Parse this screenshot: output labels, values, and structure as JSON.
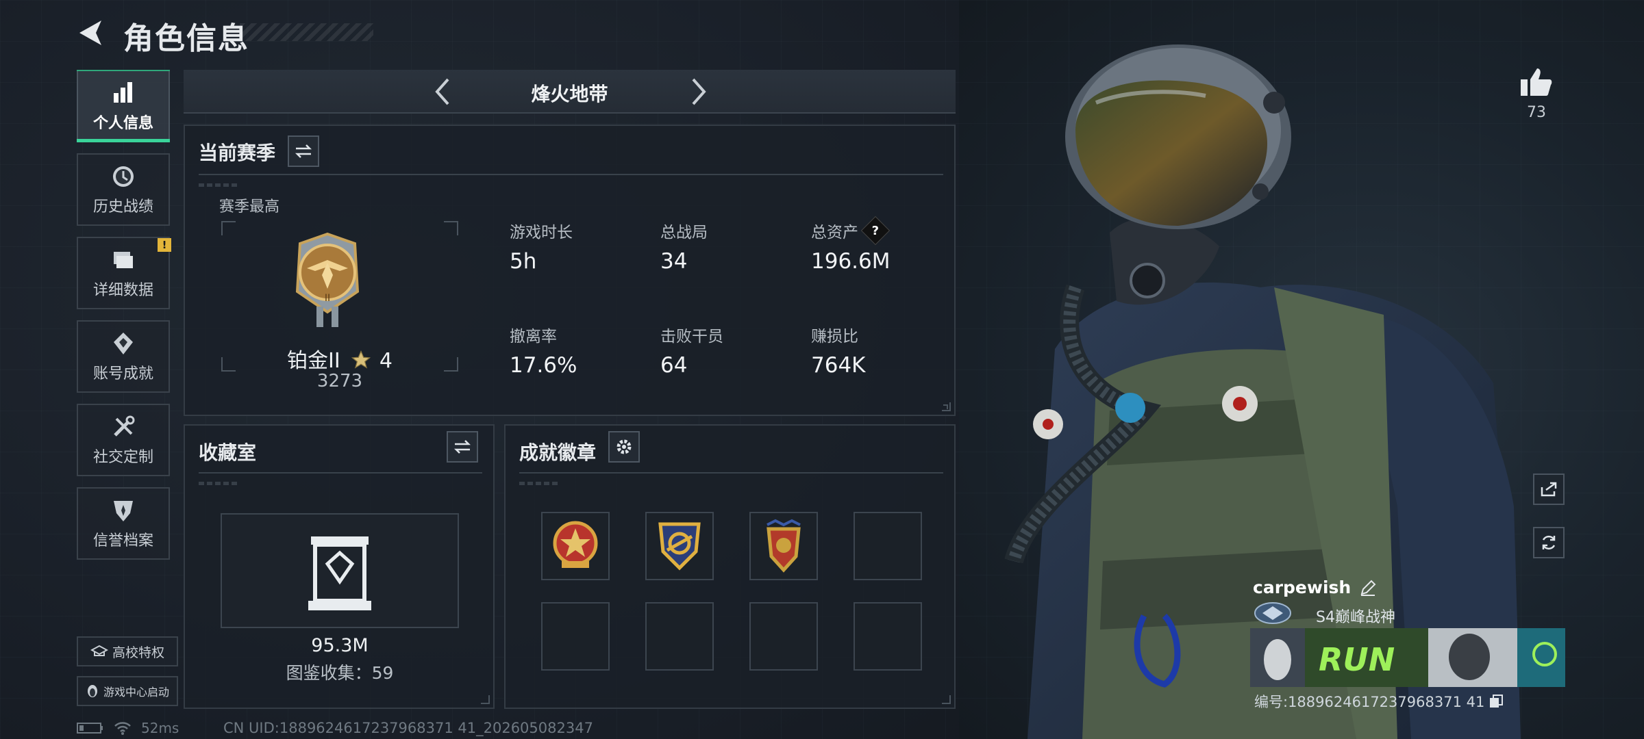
{
  "header": {
    "title": "角色信息"
  },
  "sidebar": {
    "items": [
      {
        "label": "个人信息",
        "icon": "bar-chart-icon",
        "active": true
      },
      {
        "label": "历史战绩",
        "icon": "history-clock-icon"
      },
      {
        "label": "详细数据",
        "icon": "folders-icon",
        "badge": "!"
      },
      {
        "label": "账号成就",
        "icon": "achievement-icon"
      },
      {
        "label": "社交定制",
        "icon": "tools-icon"
      },
      {
        "label": "信誉档案",
        "icon": "shield-star-icon"
      }
    ],
    "campus_label": "高校特权",
    "game_center_label": "游戏中心启动"
  },
  "mode": {
    "title": "烽火地带"
  },
  "season": {
    "header": "当前赛季",
    "best_label": "赛季最高",
    "rank": "铂金II",
    "stars": "4",
    "score": "3273",
    "stats": [
      {
        "label": "游戏时长",
        "value": "5h"
      },
      {
        "label": "总战局",
        "value": "34"
      },
      {
        "label": "总资产",
        "value": "196.6M",
        "help": "?"
      },
      {
        "label": "撤离率",
        "value": "17.6%"
      },
      {
        "label": "击败干员",
        "value": "64"
      },
      {
        "label": "赚损比",
        "value": "764K"
      }
    ]
  },
  "collection": {
    "header": "收藏室",
    "value": "95.3M",
    "count_label": "图鉴收集：59"
  },
  "badges": {
    "header": "成就徽章",
    "slots": [
      {
        "filled": true,
        "colors": [
          "#b8342c",
          "#d9a441"
        ]
      },
      {
        "filled": true,
        "colors": [
          "#2b3e78",
          "#e0b040"
        ]
      },
      {
        "filled": true,
        "colors": [
          "#b23a2a",
          "#caa23e"
        ]
      },
      {
        "filled": false
      },
      {
        "filled": false
      },
      {
        "filled": false
      },
      {
        "filled": false
      },
      {
        "filled": false
      }
    ]
  },
  "likes": {
    "count": "73"
  },
  "player": {
    "name": "carpewish",
    "title": "S4巅峰战神",
    "id_label": "编号:1889624617237968371 41",
    "banner_text": "RUN"
  },
  "status": {
    "latency": "52ms",
    "uid": "CN UID:1889624617237968371 41_202605082347"
  },
  "colors": {
    "accent": "#3ad49a",
    "warning": "#e3b53a"
  }
}
